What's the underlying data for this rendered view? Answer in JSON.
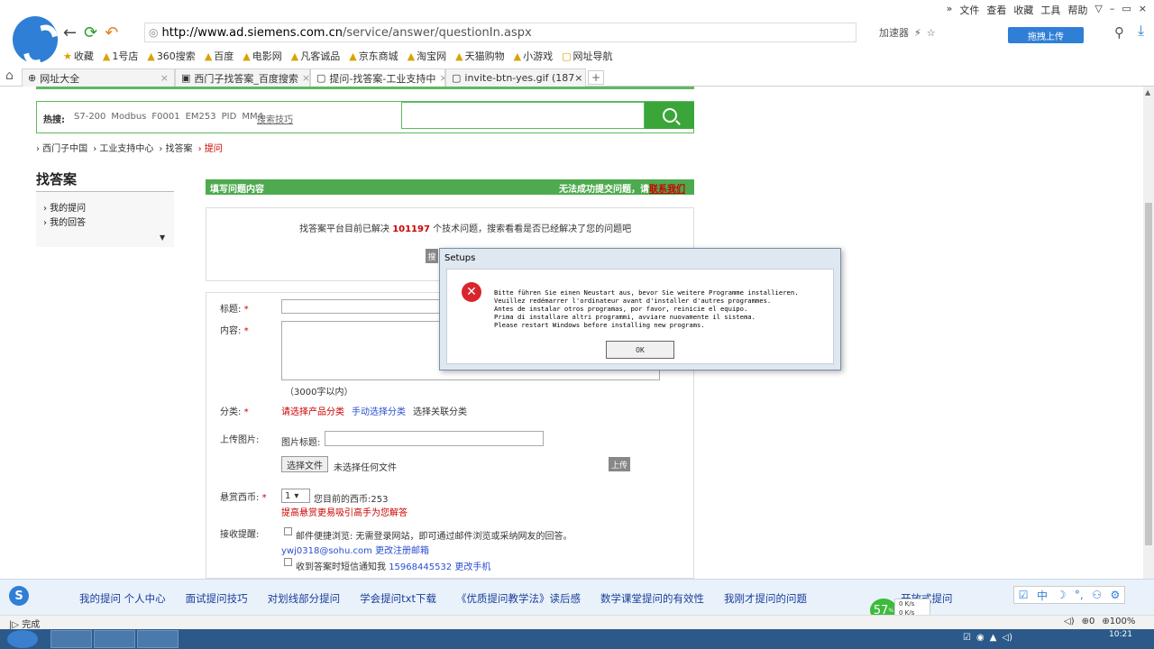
{
  "browser": {
    "menu": [
      "»",
      "文件",
      "查看",
      "收藏",
      "工具",
      "帮助"
    ],
    "window_controls": [
      "▽",
      "–",
      "▭",
      "×"
    ],
    "url_host": "http://www.ad.siemens.com.cn",
    "url_path": "/service/answer/questionIn.aspx",
    "accelerator_label": "加速器",
    "upload_label": "拖拽上传",
    "bookmarks": [
      "收藏",
      "1号店",
      "360搜索",
      "百度",
      "电影网",
      "凡客诚品",
      "京东商城",
      "淘宝网",
      "天猫购物",
      "小游戏",
      "网址导航"
    ],
    "tabs": [
      {
        "label": "网址大全"
      },
      {
        "label": "西门子找答案_百度搜索"
      },
      {
        "label": "提问-找答案-工业支持中"
      },
      {
        "label": "invite-btn-yes.gif (187×"
      }
    ]
  },
  "page": {
    "hot_label": "热搜:",
    "hot_links": [
      "S7-200",
      "Modbus",
      "F0001",
      "EM253",
      "PID",
      "MM4"
    ],
    "search_tips": "搜索技巧",
    "breadcrumb": [
      "› 西门子中国",
      "› 工业支持中心",
      "› 找答案",
      "› 提问"
    ],
    "side_title": "找答案",
    "side_links": [
      "› 我的提问",
      "› 我的回答"
    ],
    "form_header_left": "填写问题内容",
    "form_header_right": "无法成功提交问题，请",
    "contact_link": "联系我们",
    "solved_prefix": "找答案平台目前已解决",
    "solved_count": "101197",
    "solved_suffix": "个技术问题，搜索看看是否已经解决了您的问题吧",
    "solved_btn": "搜",
    "label_title": "标题:",
    "label_content": "内容:",
    "limit_text": "（3000字以内）",
    "label_category": "分类:",
    "cat_link_1": "请选择产品分类",
    "cat_link_2": "手动选择分类",
    "cat_link_3": "选择关联分类",
    "label_upload": "上传图片:",
    "pic_title_label": "图片标题:",
    "choose_file": "选择文件",
    "no_file": "未选择任何文件",
    "upload_btn": "上传",
    "label_reward": "悬赏西币:",
    "coin_value": "1",
    "coin_now": "您目前的西币:253",
    "coin_tip": "提高悬赏更易吸引高手为您解答",
    "label_notify": "接收提醒:",
    "mail_text": "邮件便捷浏览: 无需登录网站，即可通过邮件浏览或采纳网友的回答。",
    "mail_addr": "ywj0318@sohu.com",
    "mail_change": "更改注册邮箱",
    "sms_text": "收到答案时短信通知我",
    "sms_phone": "15968445532",
    "sms_change": "更改手机"
  },
  "dialog": {
    "title": "Setups",
    "message": "Bitte führen Sie einen Neustart aus, bevor Sie weitere Programme installieren.\nVeuillez redémarrer l'ordinateur avant d'installer d'autres programmes.\nAntes de instalar otros programas, por favor, reinicie el equipo.\nPrima di installare altri programmi, avviare nuovamente il sistema.\nPlease restart Windows before installing new programs.",
    "ok_label": "OK"
  },
  "bottom": {
    "links": [
      "我的提问 个人中心",
      "面试提问技巧",
      "对划线部分提问",
      "学会提问txt下载",
      "《优质提问教学法》读后感",
      "数学课堂提问的有效性",
      "我刚才提问的问题",
      "",
      "开放式提问"
    ],
    "speed_percent": "57",
    "speed_up": "0 K/s",
    "speed_down": "0 K/s",
    "status_left": "完成",
    "status_right": [
      "0",
      "100%"
    ],
    "clock_time": "10:21"
  }
}
